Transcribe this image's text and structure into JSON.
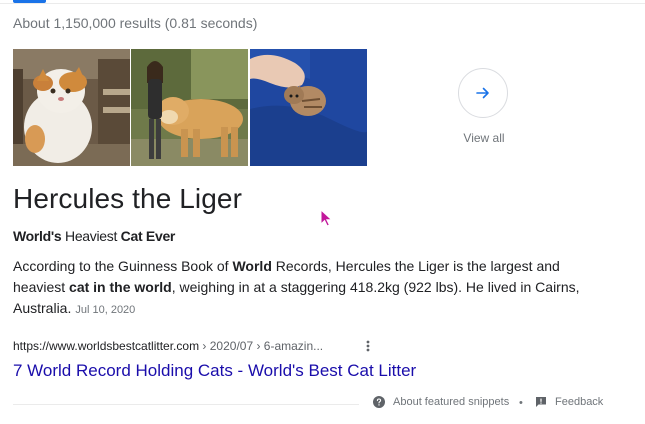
{
  "results": {
    "stats": "About 1,150,000 results (0.81 seconds)"
  },
  "images": {
    "items": [
      {
        "alt": "cat-on-bench-photo"
      },
      {
        "alt": "woman-with-liger-photo"
      },
      {
        "alt": "hand-with-kitten-photo"
      }
    ],
    "view_all_label": "View all",
    "view_all_icon": "arrow-right-icon"
  },
  "featured": {
    "title": "Hercules the Liger",
    "subtitle": {
      "part1": "World's",
      "part2": " Heaviest ",
      "part3": "Cat Ever"
    },
    "snippet": {
      "t1": "According to the Guinness Book of ",
      "b1": "World",
      "t2": " Records, Hercules the Liger is the largest and heaviest ",
      "b2": "cat in the world",
      "t3": ", weighing in at a staggering 418.2kg (922 lbs). He lived in Cairns, Australia.",
      "date": "Jul 10, 2020"
    },
    "source_url": "https://www.worldsbestcatlitter.com",
    "source_path": " › 2020/07 › 6-amazin...",
    "link_title": "7 World Record Holding Cats - World's Best Cat Litter"
  },
  "footer": {
    "about_label": "About featured snippets",
    "bullet": "•",
    "feedback_label": "Feedback"
  },
  "colors": {
    "accent": "#1a73e8",
    "link": "#1a0dab",
    "muted": "#70757a",
    "cursor": "#c2189b"
  }
}
